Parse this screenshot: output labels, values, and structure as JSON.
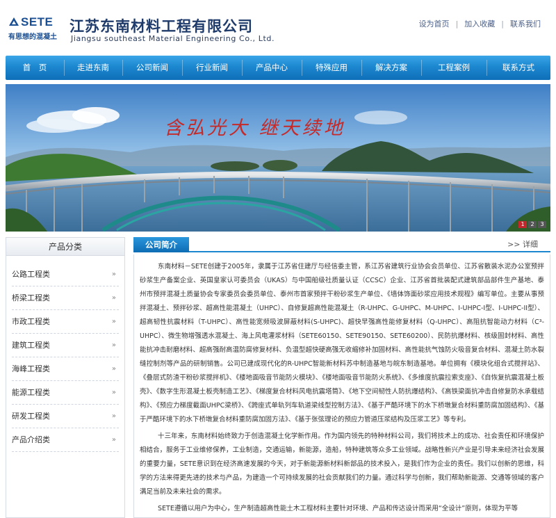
{
  "header": {
    "logo_text": "SETE",
    "logo_slogan": "有思想的混凝土",
    "company_name_cn": "江苏东南材料工程有限公司",
    "company_name_en": "Jiangsu southeast Material Engineering Co., Ltd.",
    "links": [
      "设为首页",
      "加入收藏",
      "联系我们"
    ]
  },
  "nav": {
    "items": [
      "首　页",
      "走进东南",
      "公司新闻",
      "行业新闻",
      "产品中心",
      "特殊应用",
      "解决方案",
      "工程案例",
      "联系方式"
    ]
  },
  "banner": {
    "calligraphy": "含弘光大 继天续地",
    "slides": [
      "1",
      "2",
      "3"
    ],
    "active_slide": 1
  },
  "sidebar": {
    "title": "产品分类",
    "items": [
      "公路工程类",
      "桥梁工程类",
      "市政工程类",
      "建筑工程类",
      "海峰工程类",
      "能源工程类",
      "研发工程类",
      "产品介绍类"
    ]
  },
  "main": {
    "section_title": "公司简介",
    "more_label": "详细",
    "paragraphs": [
      "东南材料－SETE创建于2005年，隶属于江苏省住建厅与经信委主管，系江苏省建筑行业协会会员单位、江苏省散装水泥办公室预拌砂浆生产备案企业、英国皇家认可委员会（UKAS）与中国船级社质量认证（CCSC）企业、江苏省首批装配式建筑部品部件生产基地、泰州市预拌混凝土质量协会专家委员会委员单位、泰州市首家预拌干粉砂浆生产单位、《墙体饰面砂浆应用技术规程》编写单位。主要从事预拌混凝土、预拌砂浆、超高性能混凝土（UHPC）、自修复超高性能混凝土（R-UHPC、G-UHPC、M-UHPC、I-UHPC-I型、I-UHPC-II型）、超高韧性抗震材料（T-UHPC）、高性能宽频吸波屏蔽材料(S-UHPC)、超快早强高性能修复材料（Q-UHPC）、高阻抗智能动力材料（C³-UHPC）、微生物增强透水混凝土、海上风电灌浆材料（SETE60150、SETE90150、SETE60200）、民防抗爆材料、核级固封材料、高性能抗冲击耐磨材料、超高强耐高温防腐修复材料、负温型超快硬高强无收缩修补加固材料、高性能抗气蚀防火吸音复合材料、混凝土防水裂缝控制剂等产品的研制销售。公司已建成现代化的R-UHPC智能新材料苏中制造基地与皖东制造基地。单位拥有《模块化组合式搅拌站》、《叠层式防渣干粉砂浆搅拌机》、《楼地面吸音节能防火模块》、《楼地面吸音节能防火系统》、《多维度抗震拉索支座》、《自恢复抗震混凝土板壳》、《数字生形混凝土板壳制造工艺》、《梯度复合材料风电抗震塔筒》、《地下空间韧性人防抗爆结构》、《高铁梁面抗冲击自修复防水承载结构》、《预应力梯度截面UHPC梁桥》、《跨座式单轨列车轨道梁线型控制方法》、《基于严酷环境下的水下桥墩复合材料重防腐加固结构》、《基于严酷环境下的水下桥墩复合材料重防腐加固方法》、《基于张弦理论的预应力管道压浆结构及压浆工艺》等专利。",
      "十三年来，东南材料始终致力于创造混凝土化学新作用。作为国内领先的特种材料公司，我们将技术上的成功、社会责任和环境保护相结合，服务于工业维修保养，工业制造，交通运输，新能源，造船，特种建筑等众多工业领域。战略性新兴产业是引导未来经济社会发展的重要力量，SETE意识到在经济高速发展的今天，对于新能源新材料新部品的技术投入，是我们作为企业的责任。我们以创新的思维，科学的方法来得更先进的技术与产品，为建造一个可持续发展的社会贡献我们的力量。通过科学与创新，我们帮助新能源、交通等领域的客户满足当前及未来社会的需求。",
      "SETE遵循以用户为中心，生产制造超高性能土木工程材料主要针对环境、产品和传达设计而采用“全设计”原则，体现为平等"
    ]
  },
  "colors": {
    "nav_blue": "#1c87cf",
    "brand_blue": "#1a4f93",
    "banner_text_red": "#c62a28",
    "active_dot": "#c1272d"
  }
}
